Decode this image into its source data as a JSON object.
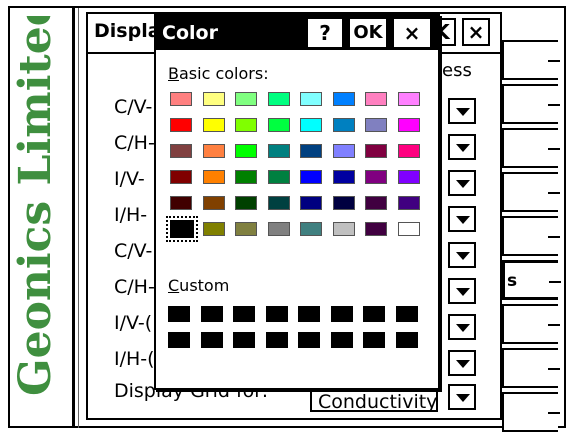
{
  "brand": {
    "text": "Geonics Limited",
    "color": "#3f8f3f"
  },
  "background_dialog": {
    "title": "Displa",
    "title_buttons": [
      "K",
      "×"
    ],
    "header_fragment": "ess",
    "rows": [
      "C/V-",
      "C/H-",
      "I/V-",
      "I/H-",
      "C/V-",
      "C/H-",
      "I/V-(",
      "I/H-("
    ],
    "bottom_label": "Display Grid for:",
    "bottom_value": "Conductivity",
    "right_fragment": "s"
  },
  "color_dialog": {
    "title": "Color",
    "help_label": "?",
    "ok_label": "OK",
    "close_label": "×",
    "basic_label_u": "B",
    "basic_label_rest": "asic colors:",
    "custom_label_u": "C",
    "custom_label_rest": "ustom",
    "selected_index": 40,
    "basic_colors": [
      "#ff8080",
      "#ffff80",
      "#80ff80",
      "#00ff80",
      "#80ffff",
      "#0080ff",
      "#ff80c0",
      "#ff80ff",
      "#ff0000",
      "#ffff00",
      "#80ff00",
      "#00ff40",
      "#00ffff",
      "#0080c0",
      "#8080c0",
      "#ff00ff",
      "#804040",
      "#ff8040",
      "#00ff00",
      "#008080",
      "#004080",
      "#8080ff",
      "#800040",
      "#ff0080",
      "#800000",
      "#ff8000",
      "#008000",
      "#008040",
      "#0000ff",
      "#0000a0",
      "#800080",
      "#8000ff",
      "#400000",
      "#804000",
      "#004000",
      "#004040",
      "#000080",
      "#000040",
      "#400040",
      "#400080",
      "#000000",
      "#808000",
      "#808040",
      "#808080",
      "#408080",
      "#c0c0c0",
      "#400040",
      "#ffffff"
    ],
    "custom_colors": [
      "#000000",
      "#000000",
      "#000000",
      "#000000",
      "#000000",
      "#000000",
      "#000000",
      "#000000",
      "#000000",
      "#000000",
      "#000000",
      "#000000",
      "#000000",
      "#000000",
      "#000000",
      "#000000"
    ]
  }
}
